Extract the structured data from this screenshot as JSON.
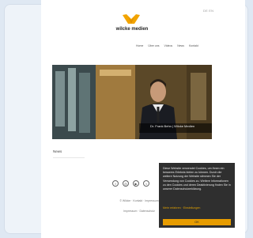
{
  "header": {
    "lang_switch": "DE EN",
    "brand": "wilcke medien"
  },
  "nav": {
    "items": [
      "Home",
      "Über uns",
      "Videos",
      "News",
      "Kontakt"
    ]
  },
  "hero": {
    "caption": "Dr. Frank Behn | Wilcke Medien"
  },
  "news": {
    "heading": "News"
  },
  "social": {
    "icons": [
      "facebook-icon",
      "instagram-icon",
      "youtube-icon",
      "twitter-icon"
    ]
  },
  "footer": {
    "line1": "© Wilcke · Kontakt · Impressum",
    "line2": "Impressum · Datenschutz"
  },
  "cookie_banner": {
    "text": "Diese Website verwendet Cookies, um Ihnen ein besseres Erlebnis bieten zu können. Durch die weitere Nutzung der Website stimmen Sie der Verwendung von Cookies zu. Weitere Informationen zu den Cookies und deren Deaktivierung finden Sie in unserer Datenschutzerklärung.",
    "links": "Mehr erfahren · Einstellungen",
    "accept_label": "OK",
    "accent_color": "#e79c00"
  },
  "colors": {
    "brand_orange": "#f2a400",
    "background": "#dfe8f3"
  }
}
